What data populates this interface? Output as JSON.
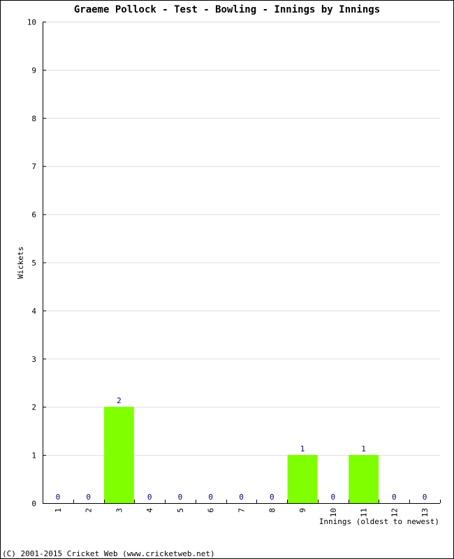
{
  "chart_data": {
    "type": "bar",
    "title": "Graeme Pollock - Test - Bowling - Innings by Innings",
    "xlabel": "Innings (oldest to newest)",
    "ylabel": "Wickets",
    "categories": [
      "1",
      "2",
      "3",
      "4",
      "5",
      "6",
      "7",
      "8",
      "9",
      "10",
      "11",
      "12",
      "13"
    ],
    "values": [
      0,
      0,
      2,
      0,
      0,
      0,
      0,
      0,
      1,
      0,
      1,
      0,
      0
    ],
    "ylim": [
      0,
      10
    ],
    "yticks": [
      0,
      1,
      2,
      3,
      4,
      5,
      6,
      7,
      8,
      9,
      10
    ],
    "grid": true,
    "bar_color": "#7fff00",
    "label_color": "#000080",
    "grid_color": "#dddddd"
  },
  "footer": {
    "copyright": "(C) 2001-2015 Cricket Web (www.cricketweb.net)"
  }
}
